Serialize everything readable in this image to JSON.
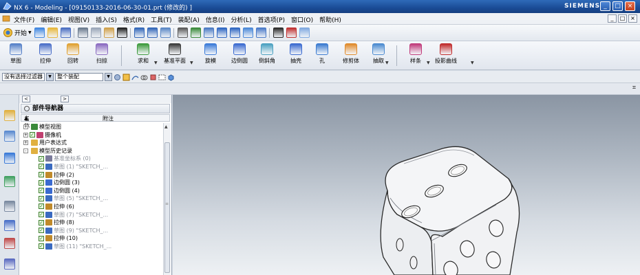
{
  "window": {
    "title": "NX 6 - Modeling - [09150133-2016-06-30-01.prt (修改的) ]",
    "brand": "SIEMENS",
    "controls": [
      "_",
      "□",
      "×"
    ]
  },
  "menubar": {
    "items": [
      "文件(F)",
      "编辑(E)",
      "视图(V)",
      "插入(S)",
      "格式(R)",
      "工具(T)",
      "装配(A)",
      "信息(I)",
      "分析(L)",
      "首选项(P)",
      "窗口(O)",
      "帮助(H)"
    ],
    "right_controls": [
      "_",
      "□",
      "×"
    ]
  },
  "std_toolbar": {
    "start_label": "开始",
    "icons": [
      "new-icon",
      "open-icon",
      "save-icon",
      "cut-icon",
      "copy-icon",
      "paste-icon",
      "delete-icon",
      "undo-icon",
      "redo-icon",
      "repeat-icon",
      "command-finder-icon",
      "fit-icon",
      "zoom-icon",
      "rotate-icon",
      "pan-icon",
      "orient-icon",
      "render-style-icon",
      "shaded-icon",
      "color-icon",
      "layer-icon"
    ]
  },
  "feature_toolbar": {
    "buttons": [
      {
        "name": "sketch",
        "label": "草图"
      },
      {
        "name": "extrude",
        "label": "拉伸"
      },
      {
        "name": "revolve",
        "label": "回转"
      },
      {
        "name": "sweep",
        "label": "扫掠"
      },
      {
        "name": "unite",
        "label": "求和"
      },
      {
        "name": "datum-plane",
        "label": "基准平面"
      },
      {
        "name": "rotate-model",
        "label": "旋模"
      },
      {
        "name": "edge-blend",
        "label": "边倒圆"
      },
      {
        "name": "chamfer",
        "label": "倒斜角"
      },
      {
        "name": "shell",
        "label": "抽壳"
      },
      {
        "name": "hole",
        "label": "孔"
      },
      {
        "name": "trim-body",
        "label": "修剪体"
      },
      {
        "name": "extract",
        "label": "抽取"
      },
      {
        "name": "spline",
        "label": "样条"
      },
      {
        "name": "project-curve",
        "label": "投影曲线"
      }
    ]
  },
  "selection_bar": {
    "filter_value": "没有选择过滤器",
    "scope_value": "整个装配"
  },
  "navigator": {
    "title": "部件导航器",
    "col_name": "名称",
    "col_note": "附注",
    "rows": [
      {
        "text": "模型视图",
        "expander": "+",
        "indent": 0,
        "check": false,
        "dim": false,
        "icon": "views-icon"
      },
      {
        "text": "摄像机",
        "expander": "+",
        "indent": 0,
        "check": true,
        "dim": false,
        "icon": "camera-icon"
      },
      {
        "text": "用户表达式",
        "expander": "+",
        "indent": 0,
        "check": false,
        "dim": false,
        "icon": "folder-icon"
      },
      {
        "text": "模型历史记录",
        "expander": "-",
        "indent": 0,
        "check": false,
        "dim": false,
        "icon": "folder-icon"
      },
      {
        "text": "基准坐标系 (0)",
        "expander": "",
        "indent": 1,
        "check": true,
        "dim": true,
        "icon": "datum-csys-icon"
      },
      {
        "text": "草图 (1) \"SKETCH_...",
        "expander": "",
        "indent": 1,
        "check": true,
        "dim": true,
        "icon": "sketch-icon"
      },
      {
        "text": "拉伸 (2)",
        "expander": "",
        "indent": 1,
        "check": true,
        "dim": false,
        "icon": "extrude-icon"
      },
      {
        "text": "边倒圆 (3)",
        "expander": "",
        "indent": 1,
        "check": true,
        "dim": false,
        "icon": "blend-icon"
      },
      {
        "text": "边倒圆 (4)",
        "expander": "",
        "indent": 1,
        "check": true,
        "dim": false,
        "icon": "blend-icon"
      },
      {
        "text": "草图 (5) \"SKETCH_...",
        "expander": "",
        "indent": 1,
        "check": true,
        "dim": true,
        "icon": "sketch-icon"
      },
      {
        "text": "拉伸 (6)",
        "expander": "",
        "indent": 1,
        "check": true,
        "dim": false,
        "icon": "extrude-icon"
      },
      {
        "text": "草图 (7) \"SKETCH_...",
        "expander": "",
        "indent": 1,
        "check": true,
        "dim": true,
        "icon": "sketch-icon"
      },
      {
        "text": "拉伸 (8)",
        "expander": "",
        "indent": 1,
        "check": true,
        "dim": false,
        "icon": "extrude-icon"
      },
      {
        "text": "草图 (9) \"SKETCH_...",
        "expander": "",
        "indent": 1,
        "check": true,
        "dim": true,
        "icon": "sketch-icon"
      },
      {
        "text": "拉伸 (10)",
        "expander": "",
        "indent": 1,
        "check": true,
        "dim": false,
        "icon": "extrude-icon"
      },
      {
        "text": "草图 (11) \"SKETCH_...",
        "expander": "",
        "indent": 1,
        "check": true,
        "dim": true,
        "icon": "sketch-icon"
      }
    ]
  },
  "resource_bar": {
    "icons": [
      "assembly-navigator-icon",
      "constraint-navigator-icon",
      "part-navigator-icon",
      "reuse-library-icon",
      "history-icon",
      "web-browser-icon",
      "palette-icon",
      "roles-icon"
    ]
  },
  "colors": {
    "title_bar": "#1a4c96",
    "viewport_top": "#8a95a3",
    "viewport_bottom": "#eef1f4",
    "model_face": "#f4f5f7",
    "model_edge": "#2a2a2a"
  }
}
